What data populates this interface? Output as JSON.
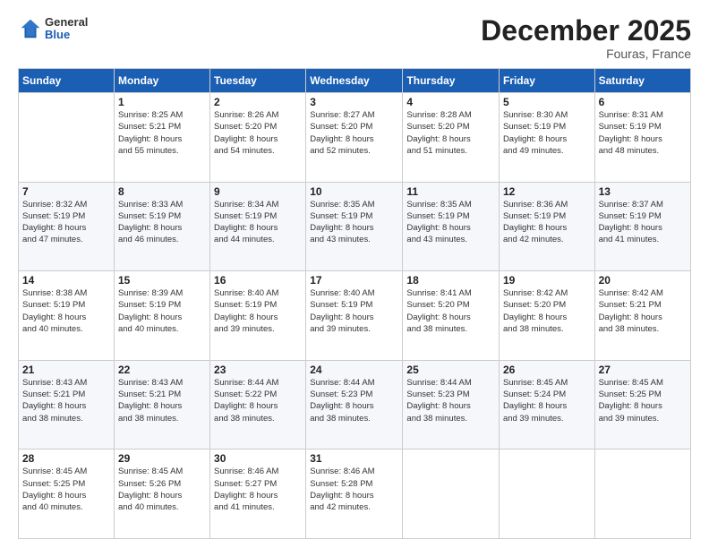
{
  "header": {
    "logo_general": "General",
    "logo_blue": "Blue",
    "month": "December 2025",
    "location": "Fouras, France"
  },
  "weekdays": [
    "Sunday",
    "Monday",
    "Tuesday",
    "Wednesday",
    "Thursday",
    "Friday",
    "Saturday"
  ],
  "weeks": [
    [
      {
        "day": "",
        "info": ""
      },
      {
        "day": "1",
        "info": "Sunrise: 8:25 AM\nSunset: 5:21 PM\nDaylight: 8 hours\nand 55 minutes."
      },
      {
        "day": "2",
        "info": "Sunrise: 8:26 AM\nSunset: 5:20 PM\nDaylight: 8 hours\nand 54 minutes."
      },
      {
        "day": "3",
        "info": "Sunrise: 8:27 AM\nSunset: 5:20 PM\nDaylight: 8 hours\nand 52 minutes."
      },
      {
        "day": "4",
        "info": "Sunrise: 8:28 AM\nSunset: 5:20 PM\nDaylight: 8 hours\nand 51 minutes."
      },
      {
        "day": "5",
        "info": "Sunrise: 8:30 AM\nSunset: 5:19 PM\nDaylight: 8 hours\nand 49 minutes."
      },
      {
        "day": "6",
        "info": "Sunrise: 8:31 AM\nSunset: 5:19 PM\nDaylight: 8 hours\nand 48 minutes."
      }
    ],
    [
      {
        "day": "7",
        "info": "Sunrise: 8:32 AM\nSunset: 5:19 PM\nDaylight: 8 hours\nand 47 minutes."
      },
      {
        "day": "8",
        "info": "Sunrise: 8:33 AM\nSunset: 5:19 PM\nDaylight: 8 hours\nand 46 minutes."
      },
      {
        "day": "9",
        "info": "Sunrise: 8:34 AM\nSunset: 5:19 PM\nDaylight: 8 hours\nand 44 minutes."
      },
      {
        "day": "10",
        "info": "Sunrise: 8:35 AM\nSunset: 5:19 PM\nDaylight: 8 hours\nand 43 minutes."
      },
      {
        "day": "11",
        "info": "Sunrise: 8:35 AM\nSunset: 5:19 PM\nDaylight: 8 hours\nand 43 minutes."
      },
      {
        "day": "12",
        "info": "Sunrise: 8:36 AM\nSunset: 5:19 PM\nDaylight: 8 hours\nand 42 minutes."
      },
      {
        "day": "13",
        "info": "Sunrise: 8:37 AM\nSunset: 5:19 PM\nDaylight: 8 hours\nand 41 minutes."
      }
    ],
    [
      {
        "day": "14",
        "info": "Sunrise: 8:38 AM\nSunset: 5:19 PM\nDaylight: 8 hours\nand 40 minutes."
      },
      {
        "day": "15",
        "info": "Sunrise: 8:39 AM\nSunset: 5:19 PM\nDaylight: 8 hours\nand 40 minutes."
      },
      {
        "day": "16",
        "info": "Sunrise: 8:40 AM\nSunset: 5:19 PM\nDaylight: 8 hours\nand 39 minutes."
      },
      {
        "day": "17",
        "info": "Sunrise: 8:40 AM\nSunset: 5:19 PM\nDaylight: 8 hours\nand 39 minutes."
      },
      {
        "day": "18",
        "info": "Sunrise: 8:41 AM\nSunset: 5:20 PM\nDaylight: 8 hours\nand 38 minutes."
      },
      {
        "day": "19",
        "info": "Sunrise: 8:42 AM\nSunset: 5:20 PM\nDaylight: 8 hours\nand 38 minutes."
      },
      {
        "day": "20",
        "info": "Sunrise: 8:42 AM\nSunset: 5:21 PM\nDaylight: 8 hours\nand 38 minutes."
      }
    ],
    [
      {
        "day": "21",
        "info": "Sunrise: 8:43 AM\nSunset: 5:21 PM\nDaylight: 8 hours\nand 38 minutes."
      },
      {
        "day": "22",
        "info": "Sunrise: 8:43 AM\nSunset: 5:21 PM\nDaylight: 8 hours\nand 38 minutes."
      },
      {
        "day": "23",
        "info": "Sunrise: 8:44 AM\nSunset: 5:22 PM\nDaylight: 8 hours\nand 38 minutes."
      },
      {
        "day": "24",
        "info": "Sunrise: 8:44 AM\nSunset: 5:23 PM\nDaylight: 8 hours\nand 38 minutes."
      },
      {
        "day": "25",
        "info": "Sunrise: 8:44 AM\nSunset: 5:23 PM\nDaylight: 8 hours\nand 38 minutes."
      },
      {
        "day": "26",
        "info": "Sunrise: 8:45 AM\nSunset: 5:24 PM\nDaylight: 8 hours\nand 39 minutes."
      },
      {
        "day": "27",
        "info": "Sunrise: 8:45 AM\nSunset: 5:25 PM\nDaylight: 8 hours\nand 39 minutes."
      }
    ],
    [
      {
        "day": "28",
        "info": "Sunrise: 8:45 AM\nSunset: 5:25 PM\nDaylight: 8 hours\nand 40 minutes."
      },
      {
        "day": "29",
        "info": "Sunrise: 8:45 AM\nSunset: 5:26 PM\nDaylight: 8 hours\nand 40 minutes."
      },
      {
        "day": "30",
        "info": "Sunrise: 8:46 AM\nSunset: 5:27 PM\nDaylight: 8 hours\nand 41 minutes."
      },
      {
        "day": "31",
        "info": "Sunrise: 8:46 AM\nSunset: 5:28 PM\nDaylight: 8 hours\nand 42 minutes."
      },
      {
        "day": "",
        "info": ""
      },
      {
        "day": "",
        "info": ""
      },
      {
        "day": "",
        "info": ""
      }
    ]
  ]
}
